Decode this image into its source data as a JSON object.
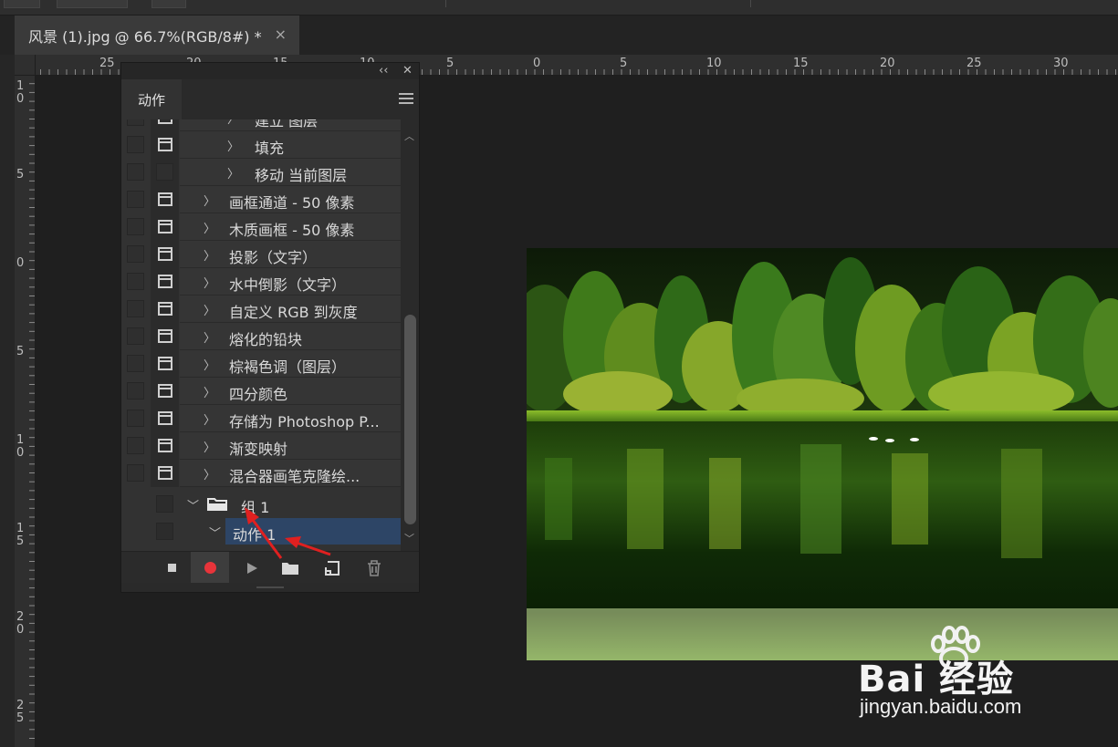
{
  "document_tab": {
    "title": "风景 (1).jpg @ 66.7%(RGB/8#) *",
    "close": "×"
  },
  "ruler": {
    "horizontal_labels": [
      "25",
      "20",
      "15",
      "10",
      "5",
      "0",
      "5",
      "10",
      "15",
      "20",
      "25",
      "30"
    ],
    "vertical_labels": [
      "1\n0",
      "5",
      "0",
      "5",
      "1\n0",
      "1\n5",
      "2\n0",
      "2\n5"
    ]
  },
  "actions_panel": {
    "header_controls": {
      "collapse": "‹‹",
      "close": "✕"
    },
    "tab": "动作",
    "rows": [
      {
        "label": "建立 图层",
        "level": 2,
        "check_icon": true
      },
      {
        "label": "填充",
        "level": 2,
        "check_icon": true
      },
      {
        "label": "移动 当前图层",
        "level": 2,
        "check_icon": false
      },
      {
        "label": "画框通道 - 50 像素",
        "level": 1,
        "check_icon": true
      },
      {
        "label": "木质画框 - 50 像素",
        "level": 1,
        "check_icon": true
      },
      {
        "label": "投影（文字）",
        "level": 1,
        "check_icon": true
      },
      {
        "label": "水中倒影（文字）",
        "level": 1,
        "check_icon": true
      },
      {
        "label": "自定义 RGB 到灰度",
        "level": 1,
        "check_icon": true
      },
      {
        "label": "熔化的铅块",
        "level": 1,
        "check_icon": true
      },
      {
        "label": "棕褐色调（图层）",
        "level": 1,
        "check_icon": true
      },
      {
        "label": "四分颜色",
        "level": 1,
        "check_icon": true
      },
      {
        "label": "存储为 Photoshop P...",
        "level": 1,
        "check_icon": true
      },
      {
        "label": "渐变映射",
        "level": 1,
        "check_icon": true
      },
      {
        "label": "混合器画笔克隆绘...",
        "level": 1,
        "check_icon": true
      }
    ],
    "group_row": {
      "label": "组 1"
    },
    "action_row": {
      "label": "动作 1",
      "selected": true
    },
    "toolbar": {
      "stop": "stop-recording",
      "record": "begin-recording",
      "play": "play-selection",
      "new_set": "create-new-set",
      "new_action": "create-new-action",
      "delete": "delete"
    },
    "colors": {
      "record": "#e8343a",
      "selection": "#2d4566"
    }
  },
  "watermark": {
    "brand": "Bai  经验",
    "url": "jingyan.baidu.com"
  }
}
